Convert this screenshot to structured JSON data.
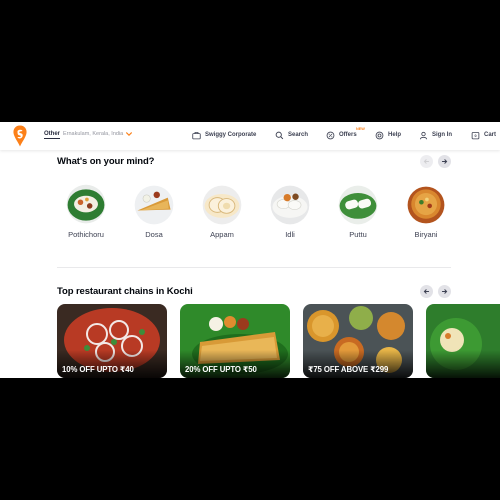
{
  "header": {
    "location_primary": "Other",
    "location_secondary": "Ernakulam, Kerala, India",
    "nav": {
      "corporate": "Swiggy Corporate",
      "search": "Search",
      "offers": "Offers",
      "offers_badge": "NEW",
      "help": "Help",
      "signin": "Sign In",
      "cart": "Cart"
    }
  },
  "mind": {
    "title": "What's on your mind?",
    "items": [
      {
        "label": "Pothichoru",
        "icon": "pothichoru-image"
      },
      {
        "label": "Dosa",
        "icon": "dosa-image"
      },
      {
        "label": "Appam",
        "icon": "appam-image"
      },
      {
        "label": "Idli",
        "icon": "idli-image"
      },
      {
        "label": "Puttu",
        "icon": "puttu-image"
      },
      {
        "label": "Biryani",
        "icon": "biryani-image"
      }
    ]
  },
  "chains": {
    "title": "Top restaurant chains in Kochi",
    "cards": [
      {
        "offer": "10% OFF UPTO ₹40"
      },
      {
        "offer": "20% OFF UPTO ₹50"
      },
      {
        "offer": "₹75 OFF ABOVE ₹299"
      },
      {
        "offer": ""
      }
    ]
  },
  "colors": {
    "brand": "#fc8019",
    "text": "#02060c",
    "muted": "#93959f",
    "arrow_bg": "#e2e2e7"
  }
}
